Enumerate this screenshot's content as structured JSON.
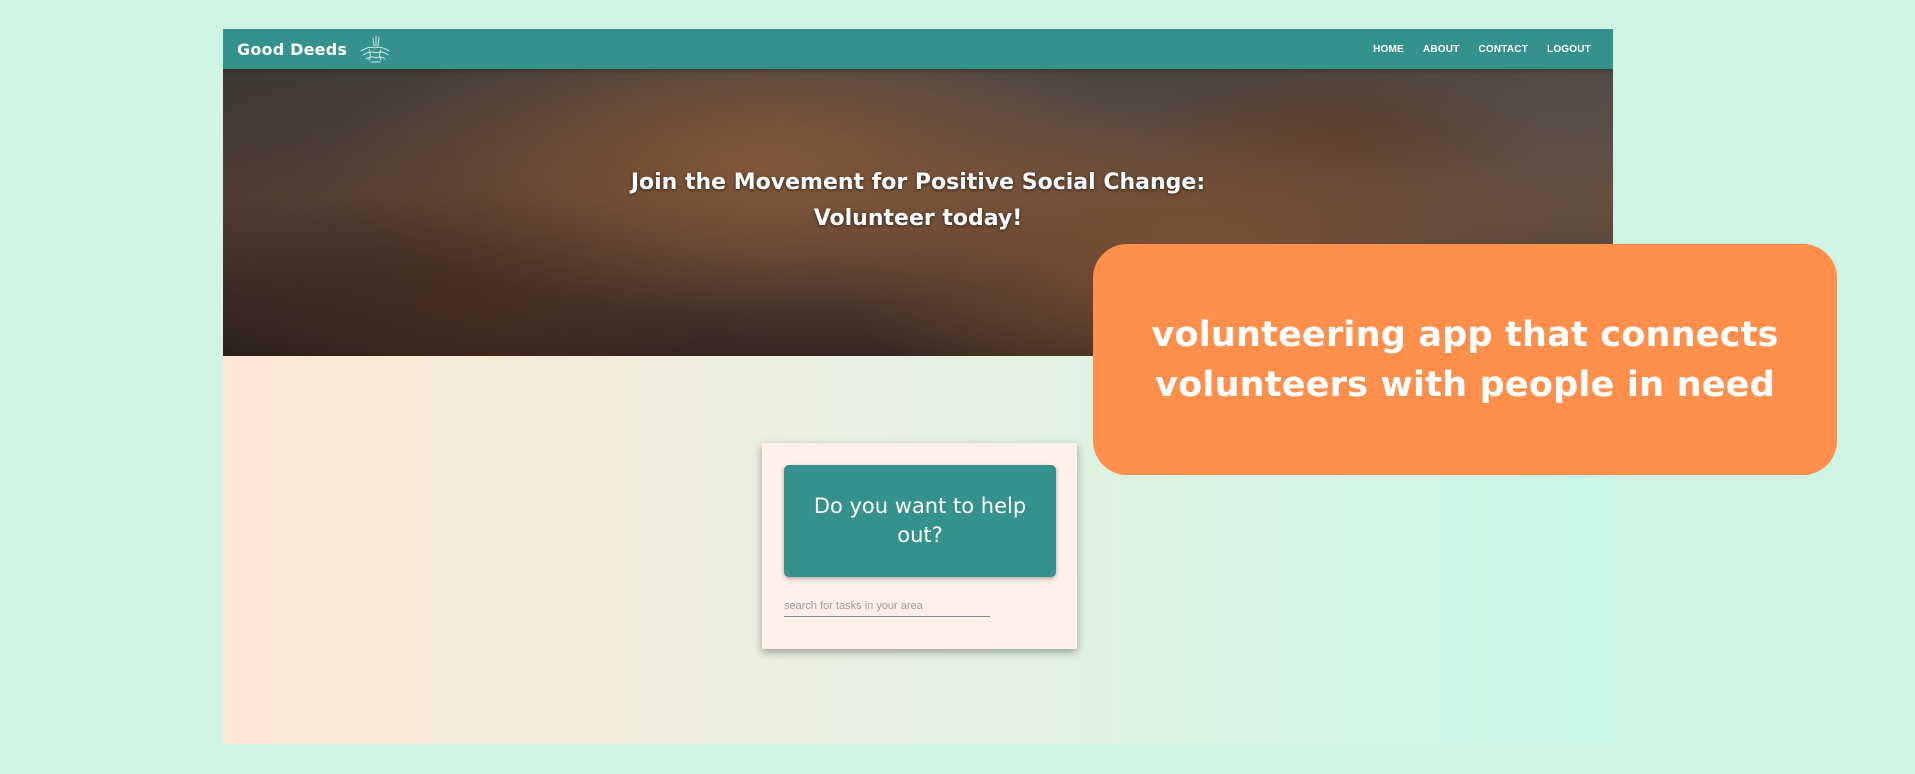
{
  "navbar": {
    "brand": "Good Deeds",
    "logo_icon": "helping-hands-icon",
    "links": [
      "HOME",
      "ABOUT",
      "CONTACT",
      "LOGOUT"
    ]
  },
  "hero": {
    "title_line1": "Join the Movement for Positive Social Change:",
    "title_line2": "Volunteer today!"
  },
  "card": {
    "button_label": "Do you want to help out?",
    "search_placeholder": "search for tasks in your area"
  },
  "callout": {
    "line1": "volunteering app that connects",
    "line2": "volunteers with people in need"
  },
  "colors": {
    "background": "#d0f4e3",
    "primary": "#34918c",
    "callout": "#ff8f4a",
    "card": "#fff0e8"
  }
}
